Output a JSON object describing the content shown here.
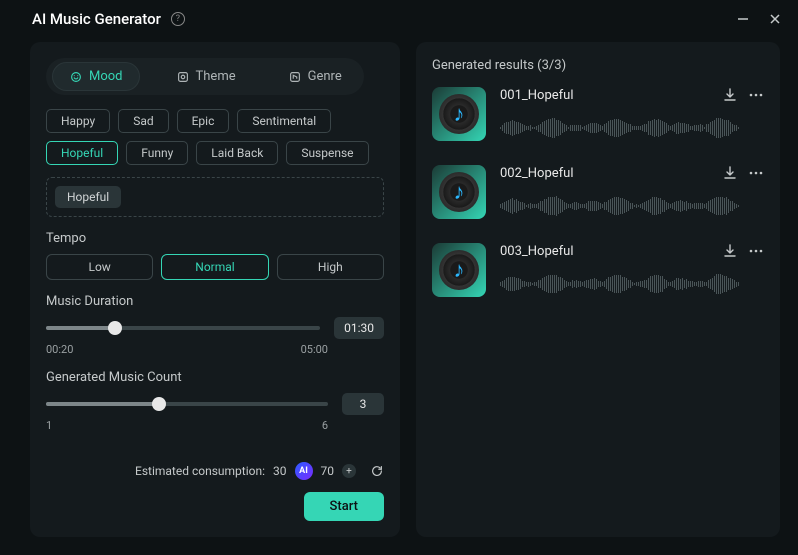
{
  "window": {
    "title": "AI Music Generator"
  },
  "tabs": [
    {
      "label": "Mood",
      "active": true
    },
    {
      "label": "Theme",
      "active": false
    },
    {
      "label": "Genre",
      "active": false
    }
  ],
  "moods": [
    {
      "label": "Happy",
      "active": false
    },
    {
      "label": "Sad",
      "active": false
    },
    {
      "label": "Epic",
      "active": false
    },
    {
      "label": "Sentimental",
      "active": false
    },
    {
      "label": "Hopeful",
      "active": true
    },
    {
      "label": "Funny",
      "active": false
    },
    {
      "label": "Laid Back",
      "active": false
    },
    {
      "label": "Suspense",
      "active": false
    }
  ],
  "selected_tag": "Hopeful",
  "tempo": {
    "label": "Tempo",
    "options": [
      {
        "label": "Low",
        "active": false
      },
      {
        "label": "Normal",
        "active": true
      },
      {
        "label": "High",
        "active": false
      }
    ]
  },
  "duration": {
    "label": "Music Duration",
    "min_label": "00:20",
    "max_label": "05:00",
    "value_label": "01:30",
    "percent": 25
  },
  "count": {
    "label": "Generated Music Count",
    "min_label": "1",
    "max_label": "6",
    "value_label": "3",
    "percent": 40
  },
  "footer": {
    "estimate_label": "Estimated consumption:",
    "estimate_value": "30",
    "credits": "70",
    "start_label": "Start"
  },
  "results": {
    "heading": "Generated results (3/3)",
    "items": [
      {
        "title": "001_Hopeful"
      },
      {
        "title": "002_Hopeful"
      },
      {
        "title": "003_Hopeful"
      }
    ]
  }
}
